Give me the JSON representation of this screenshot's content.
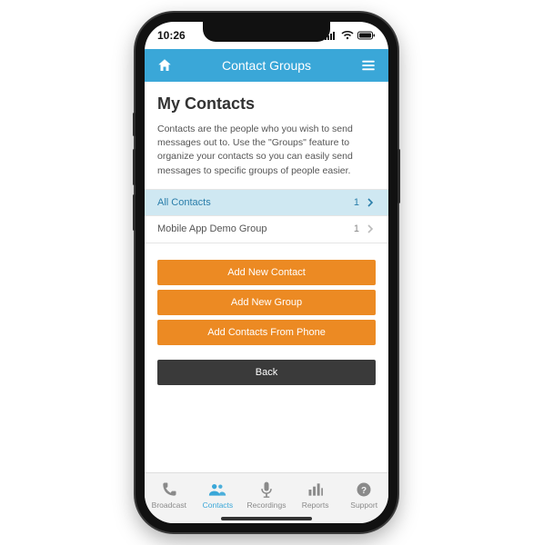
{
  "status": {
    "time": "10:26"
  },
  "nav": {
    "title": "Contact Groups"
  },
  "page": {
    "title": "My Contacts",
    "description": "Contacts are the people who you wish to send messages out to. Use the \"Groups\" feature to organize your contacts so you can easily send messages to specific groups of people easier."
  },
  "groups": [
    {
      "label": "All Contacts",
      "count": "1",
      "selected": true
    },
    {
      "label": "Mobile App Demo Group",
      "count": "1",
      "selected": false
    }
  ],
  "actions": {
    "add_contact": "Add New Contact",
    "add_group": "Add New Group",
    "add_from_phone": "Add Contacts From Phone",
    "back": "Back"
  },
  "tabs": [
    {
      "id": "broadcast",
      "label": "Broadcast",
      "icon": "phone-icon",
      "active": false
    },
    {
      "id": "contacts",
      "label": "Contacts",
      "icon": "people-icon",
      "active": true
    },
    {
      "id": "recordings",
      "label": "Recordings",
      "icon": "mic-icon",
      "active": false
    },
    {
      "id": "reports",
      "label": "Reports",
      "icon": "barchart-icon",
      "active": false
    },
    {
      "id": "support",
      "label": "Support",
      "icon": "help-icon",
      "active": false
    }
  ],
  "colors": {
    "accent": "#3aa7d8",
    "cta": "#ec8a23",
    "dark": "#3a3a3a"
  }
}
